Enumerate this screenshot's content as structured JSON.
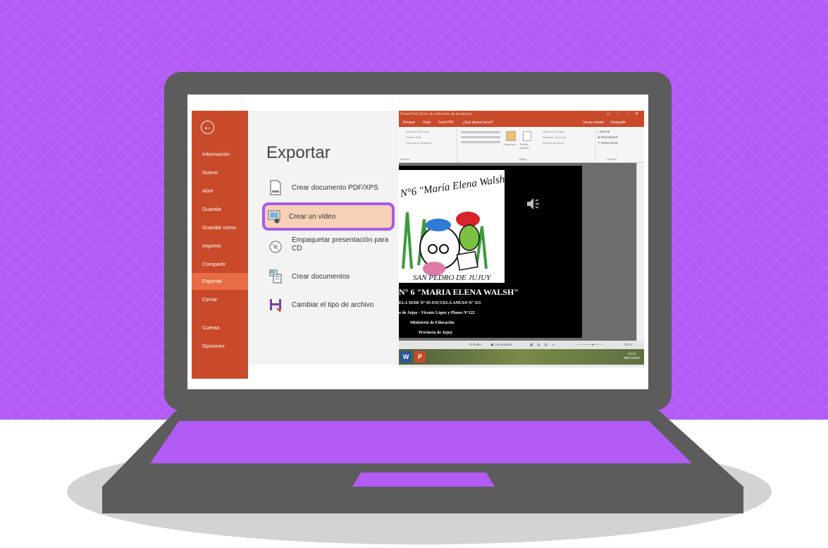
{
  "backstage": {
    "menu": [
      {
        "label": "Información",
        "active": false
      },
      {
        "label": "Nuevo",
        "active": false
      },
      {
        "label": "Abrir",
        "active": false
      },
      {
        "label": "Guardar",
        "active": false
      },
      {
        "label": "Guardar como",
        "active": false
      },
      {
        "label": "Imprimir",
        "active": false
      },
      {
        "label": "Compartir",
        "active": false
      },
      {
        "label": "Exportar",
        "active": true
      },
      {
        "label": "Cerrar",
        "active": false
      },
      {
        "label": "Cuenta",
        "active": false
      },
      {
        "label": "Opciones",
        "active": false
      }
    ],
    "back_icon": "back-arrow-icon",
    "title": "Exportar",
    "export_options": [
      {
        "label": "Crear documento PDF/XPS",
        "icon": "pdf-document-icon",
        "selected": false
      },
      {
        "label": "Crear un vídeo",
        "icon": "video-icon",
        "selected": true
      },
      {
        "label": "Empaquetar presentación para CD",
        "icon": "cd-icon",
        "selected": false
      },
      {
        "label": "Crear documentos",
        "icon": "handouts-icon",
        "selected": false
      },
      {
        "label": "Cambiar el tipo de archivo",
        "icon": "save-filetype-icon",
        "selected": false
      }
    ]
  },
  "ppt_window": {
    "title": "PowerPoint (Error de activación de productos)",
    "tabs": [
      "Revisar",
      "Vista",
      "Foxit PDF",
      "¿Qué desea hacer?"
    ],
    "account": [
      "Iniciar sesión",
      "Compartir"
    ],
    "ribbon_editing": [
      "Buscar",
      "Reemplazar",
      "Seleccionar"
    ],
    "ribbon_drawing_buttons": [
      "Organizar",
      "Estilos rápidos"
    ],
    "ribbon_shape_options": [
      "Relleno de forma",
      "Contorno de forma",
      "Efectos de forma"
    ],
    "ribbon_paragraph": [
      "Dirección del texto",
      "Alinear texto",
      "Convertir a SmartArt"
    ],
    "ribbon_group_labels": [
      "Párrafo",
      "Dibujo",
      "Edición"
    ],
    "slide": {
      "logo_arc_text": "N°6 \"María Elena Walsh\"",
      "logo_bottom_text": "SAN PEDRO DE JUJUY",
      "school_name": "N° 6 \"MARIA ELENA WALSH\"",
      "lines": [
        "ELA SEDE N° 95-ESCUELA ANEXO N° 331",
        "o de Jujuy - Vicente López y Planes N°122",
        "Ministerio de Educación",
        "Provincia de Jujuy"
      ]
    },
    "status": {
      "notes": "Notas",
      "comments": "Comentarios",
      "zoom": "76 %"
    },
    "taskbar": {
      "time": "13:21",
      "date": "08/07/2020"
    }
  },
  "colors": {
    "background": "#b25bf5",
    "laptop": "#5c5c5c",
    "backstage_accent": "#c84a2b",
    "highlight_border": "#a95ae8",
    "selected_fill": "#f8d0b8"
  }
}
